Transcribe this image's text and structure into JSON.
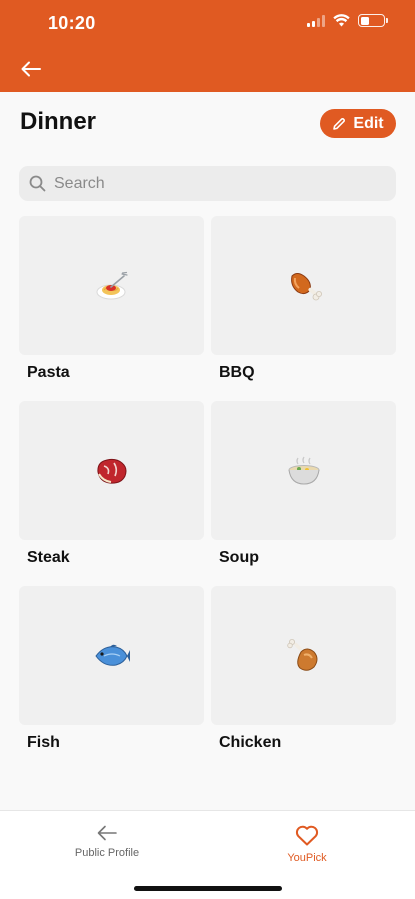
{
  "status_bar": {
    "time": "10:20"
  },
  "header": {
    "title": "Dinner",
    "edit_label": "Edit"
  },
  "search": {
    "placeholder": "Search"
  },
  "items": [
    {
      "label": "Pasta",
      "icon": "pasta-icon"
    },
    {
      "label": "BBQ",
      "icon": "meat-on-bone-icon"
    },
    {
      "label": "Steak",
      "icon": "steak-icon"
    },
    {
      "label": "Soup",
      "icon": "soup-bowl-icon"
    },
    {
      "label": "Fish",
      "icon": "fish-icon"
    },
    {
      "label": "Chicken",
      "icon": "chicken-leg-icon"
    }
  ],
  "tabbar": {
    "tabs": [
      {
        "label": "Public Profile",
        "icon": "arrow-left-icon",
        "active": false
      },
      {
        "label": "YouPick",
        "icon": "heart-icon",
        "active": true
      }
    ]
  },
  "colors": {
    "accent": "#e05a22",
    "background": "#f9f9f9",
    "tile": "#f0f0f0"
  }
}
